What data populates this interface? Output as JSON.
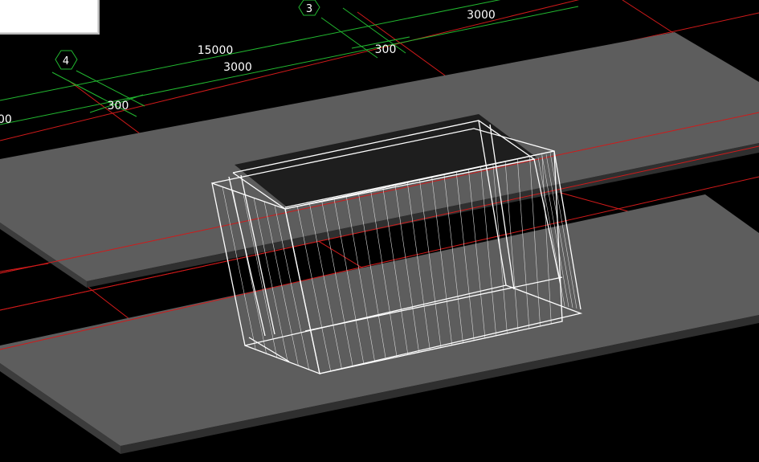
{
  "view": {
    "background": "#000000",
    "axis_color": "#d01a1a",
    "dimension_color": "#22b830",
    "slab_top_color": "#5d5d5d",
    "slab_edge_color": "#3c3c3c",
    "wireframe_color": "#ffffff"
  },
  "grid_bubbles": [
    {
      "id": "3",
      "label": "3"
    },
    {
      "id": "4",
      "label": "4"
    }
  ],
  "dimensions": [
    {
      "id": "dim-3000-top",
      "text": "3000"
    },
    {
      "id": "dim-15000",
      "text": "15000"
    },
    {
      "id": "dim-3000-mid",
      "text": "3000"
    },
    {
      "id": "dim-300-right",
      "text": "300"
    },
    {
      "id": "dim-300-left",
      "text": "300"
    },
    {
      "id": "dim-partial-left",
      "text": "00"
    }
  ],
  "panel": {
    "content": ""
  }
}
